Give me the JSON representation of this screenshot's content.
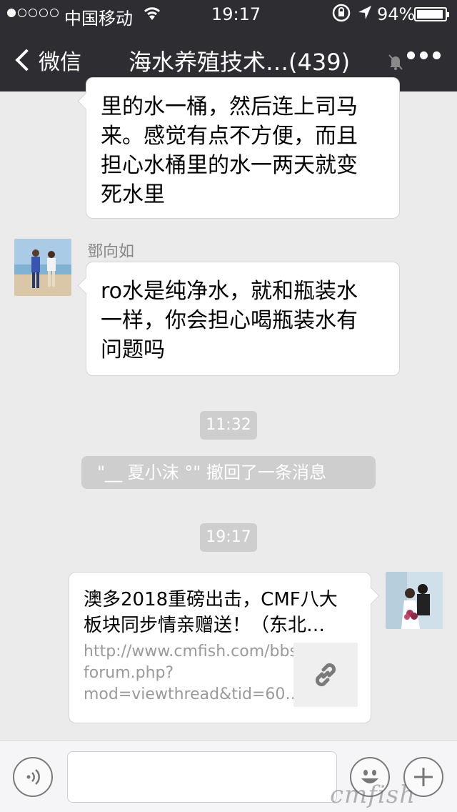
{
  "status_bar": {
    "carrier": "中国移动",
    "time": "19:17",
    "battery_pct": "94%",
    "battery_level": 0.94,
    "signal_bars": 1
  },
  "nav": {
    "back_label": "微信",
    "title": "海水养殖技术…(439)"
  },
  "messages": [
    {
      "lines": [
        "里的水一桶，然后连上司马",
        "来。感觉有点不方便，而且",
        "担心水桶里的水一两天就变",
        "死水里"
      ]
    },
    {
      "sender": "鄧向如",
      "lines": [
        "ro水是纯净水，就和瓶装水",
        "一样，你会担心喝瓶装水有",
        "问题吗"
      ]
    }
  ],
  "time_stamps": [
    "11:32",
    "19:17"
  ],
  "system_notice": "\"__ 夏小沫 °\" 撤回了一条消息",
  "link_card": {
    "title_lines": [
      "澳多2018重磅出击，CMF八大",
      "板块同步情亲赠送！（东北…"
    ],
    "url_lines": [
      "http://www.cmfish.com/bbs/",
      "forum.php?",
      "mod=viewthread&tid=60…"
    ]
  },
  "input": {
    "placeholder": ""
  },
  "watermark": "cmfish",
  "colors": {
    "nav_bg": "#2e2e32",
    "chat_bg": "#ebebeb",
    "pill_bg": "#cecece"
  }
}
